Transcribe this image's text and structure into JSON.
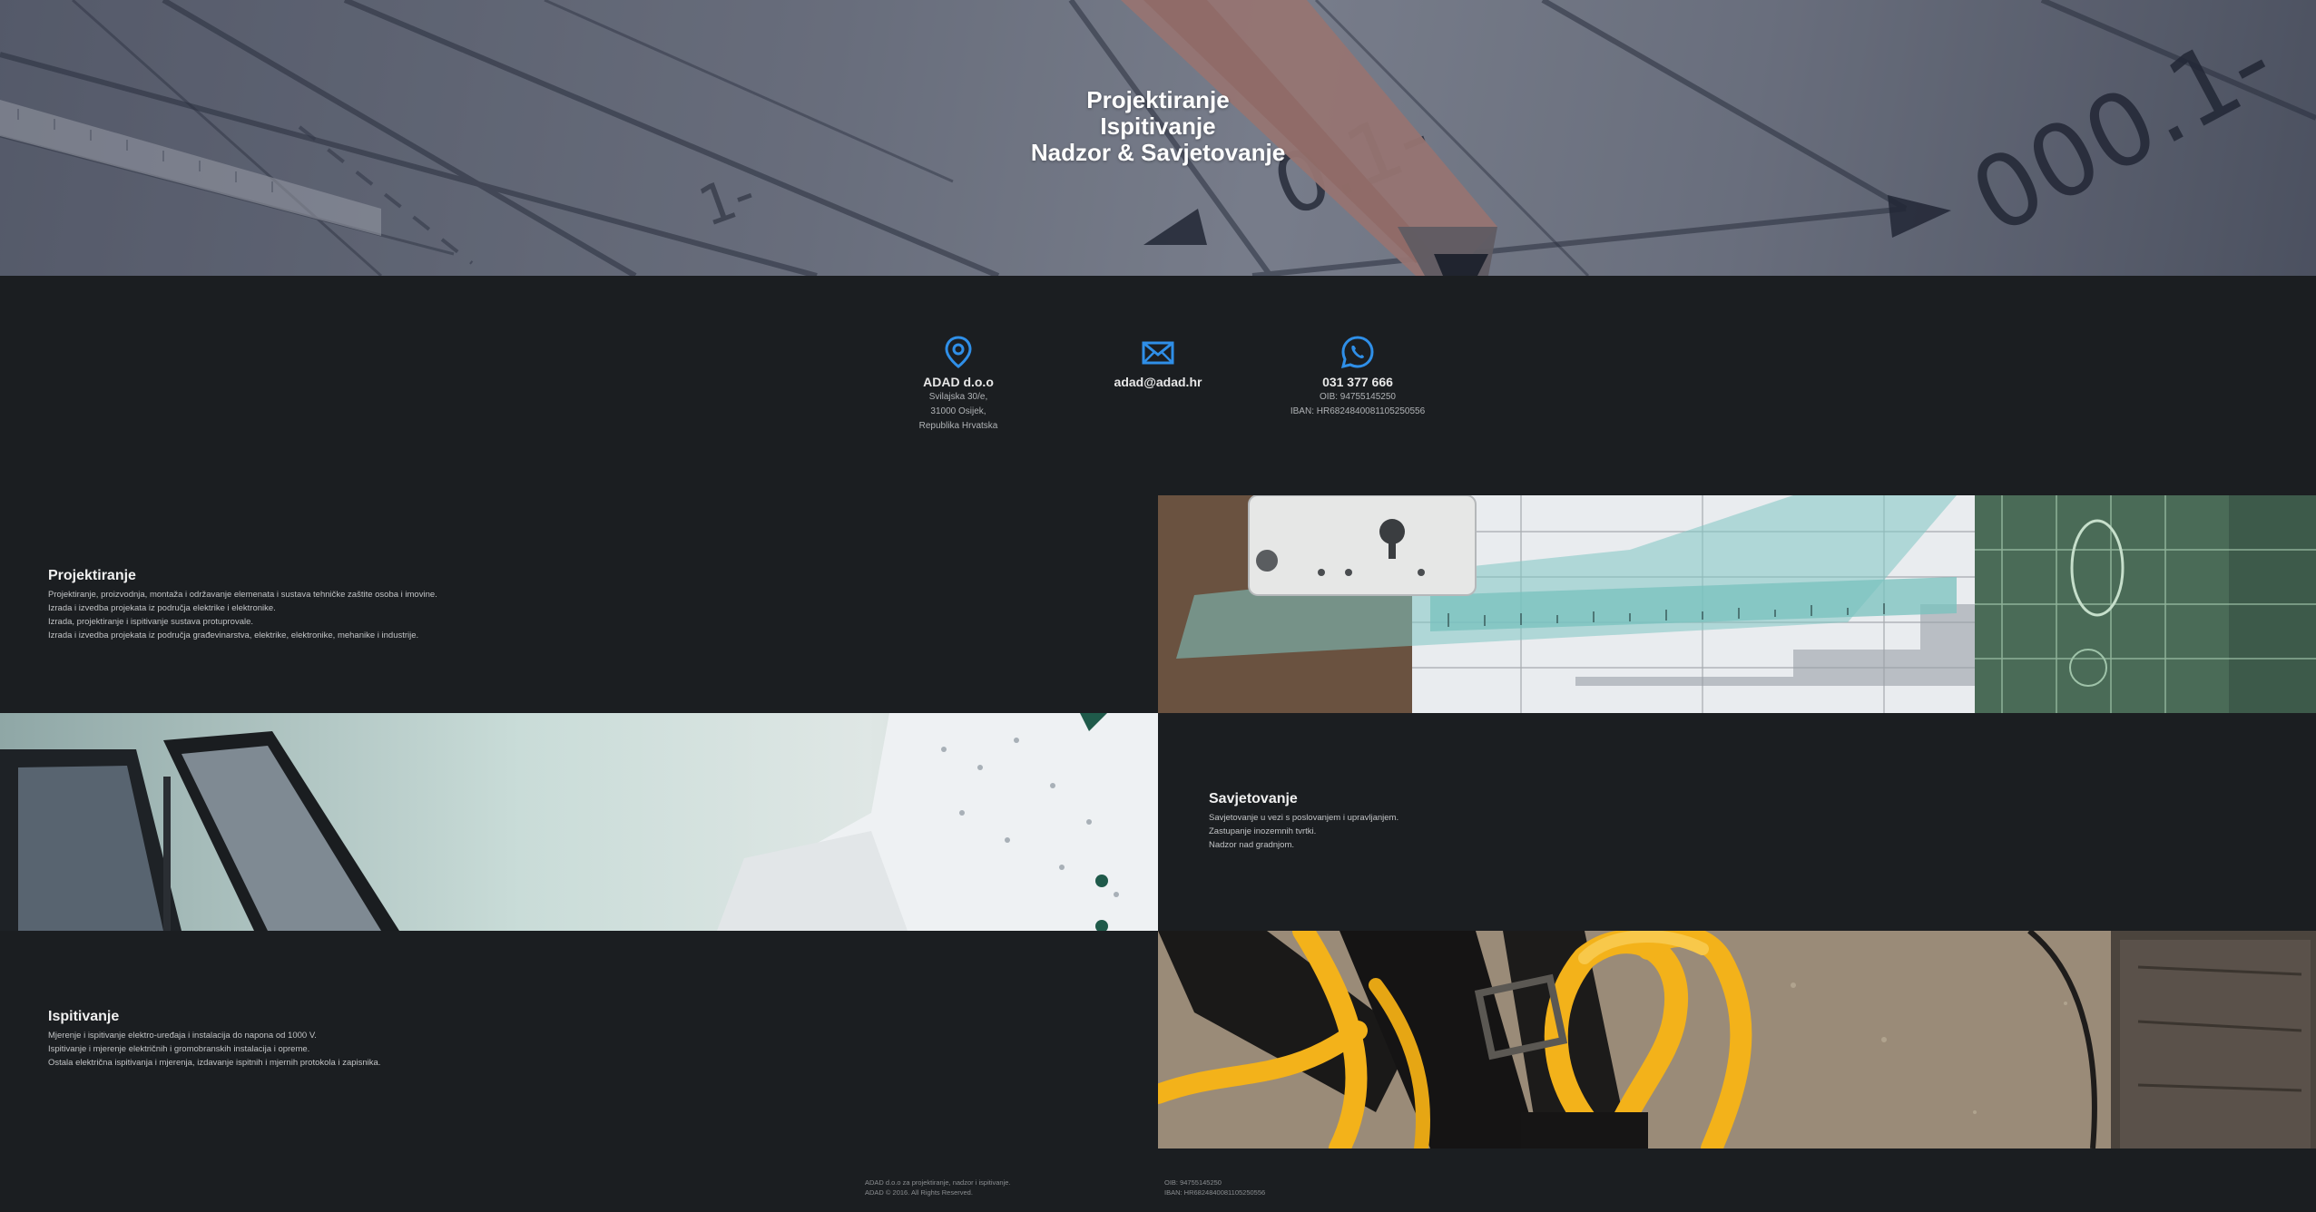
{
  "hero": {
    "lines": [
      "Projektiranje",
      "Ispitivanje",
      "Nadzor & Savjetovanje"
    ]
  },
  "contact": {
    "address": {
      "icon": "map-pin-icon",
      "title": "ADAD d.o.o",
      "lines": [
        "Svilajska 30/e,",
        "31000 Osijek,",
        "Republika Hrvatska"
      ]
    },
    "email": {
      "icon": "envelope-icon",
      "title": "adad@adad.hr"
    },
    "phone": {
      "icon": "whatsapp-icon",
      "title": "031 377 666",
      "lines": [
        "OIB: 94755145250",
        "IBAN: HR6824840081105250556"
      ]
    }
  },
  "services": [
    {
      "title": "Projektiranje",
      "lines": [
        "Projektiranje, proizvodnja, montaža i održavanje elemenata i sustava tehničke zaštite osoba i imovine.",
        "Izrada i izvedba projekata iz područja elektrike i elektronike.",
        "Izrada, projektiranje i ispitivanje sustava protuprovale.",
        "Izrada i izvedba projekata iz područja građevinarstva, elektrike, elektronike, mehanike i industrije."
      ],
      "image": "drafting-tools-photo"
    },
    {
      "title": "Savjetovanje",
      "lines": [
        "Savjetovanje u vezi s poslovanjem i upravljanjem.",
        "Zastupanje inozemnih tvrtki.",
        "Nadzor nad gradnjom."
      ],
      "image": "laptop-consultant-photo"
    },
    {
      "title": "Ispitivanje",
      "lines": [
        "Mjerenje i ispitivanje elektro-uređaja i instalacija do napona od 1000 V.",
        "Ispitivanje i mjerenje električnih i gromobranskih instalacija i opreme.",
        "Ostala električna ispitivanja i mjerenja, izdavanje ispitnih i mjernih protokola i zapisnika."
      ],
      "image": "safety-harness-photo"
    }
  ],
  "footer": {
    "left": [
      "ADAD d.o.o za projektiranje, nadzor i ispitivanje.",
      "ADAD © 2016. All Rights Reserved."
    ],
    "right": [
      "OIB: 94755145250",
      "IBAN: HR6824840081105250556"
    ]
  },
  "colors": {
    "background": "#1b1e21",
    "icon_accent": "#2f8fe8",
    "harness_yellow": "#f3b21a"
  }
}
